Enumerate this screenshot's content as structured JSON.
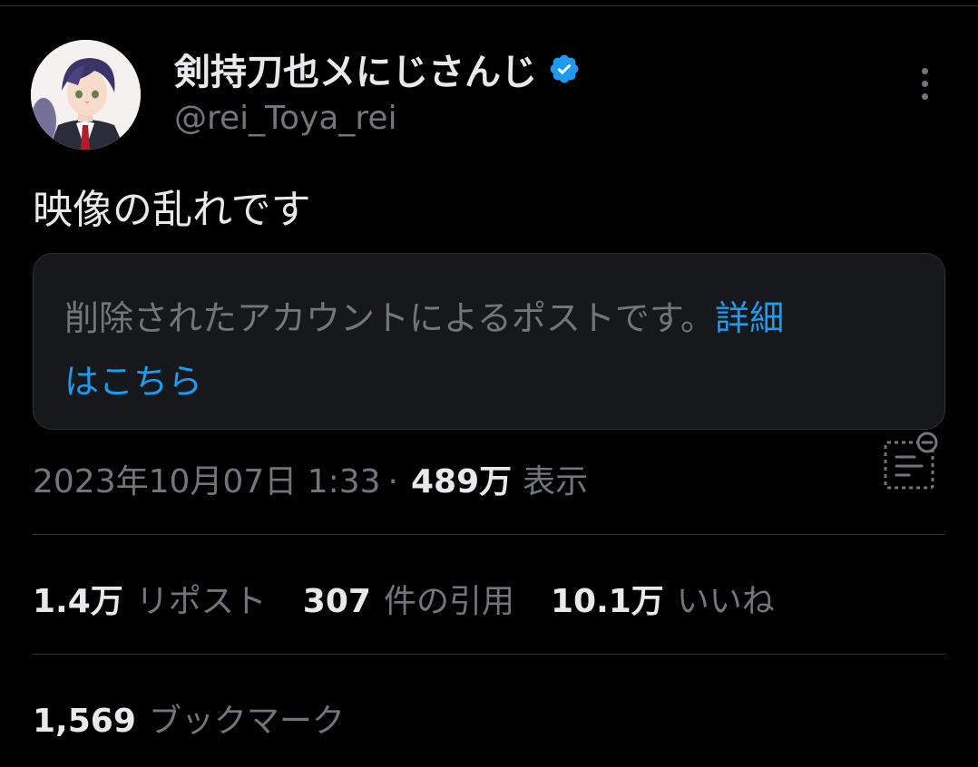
{
  "author": {
    "display_name": "剣持刀也〤にじさんじ",
    "handle": "@rei_Toya_rei",
    "verified": true,
    "avatar_icon": "avatar-portrait"
  },
  "tweet": {
    "text": "映像の乱れです"
  },
  "quoted_post": {
    "notice_text": "削除されたアカウントによるポストです。",
    "link_text_part1": "詳細",
    "link_text_part2": "はこちら"
  },
  "meta": {
    "date": "2023年10月07日 1:33",
    "separator": "·",
    "views_count": "489万",
    "views_label": "表示"
  },
  "stats": {
    "reposts_count": "1.4万",
    "reposts_label": "リポスト",
    "quotes_count": "307",
    "quotes_label": "件の引用",
    "likes_count": "10.1万",
    "likes_label": "いいね",
    "bookmarks_count": "1,569",
    "bookmarks_label": "ブックマーク"
  },
  "colors": {
    "background": "#000000",
    "text_primary": "#e7e9ea",
    "text_secondary": "#71767b",
    "accent": "#1d9bf0",
    "card_background": "#16181c",
    "border": "#2f3336"
  }
}
